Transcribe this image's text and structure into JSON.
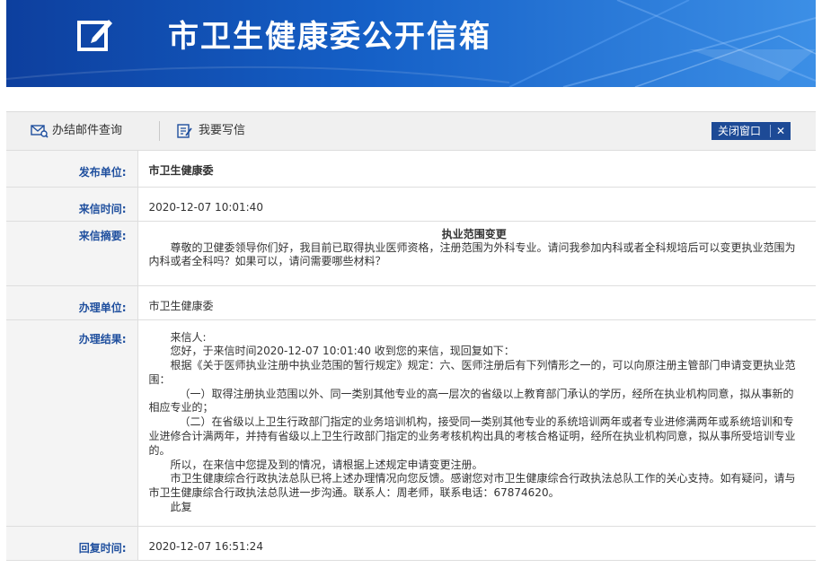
{
  "banner": {
    "title": "市卫生健康委公开信箱",
    "logo_icon": "edit-square-icon"
  },
  "toolbar": {
    "query_label": "办结邮件查询",
    "query_icon": "mail-search-icon",
    "write_label": "我要写信",
    "write_icon": "pen-paper-icon",
    "close_label": "关闭窗口",
    "close_icon": "close-x-icon"
  },
  "fields": {
    "publisher": {
      "label": "发布单位:",
      "value": "市卫生健康委"
    },
    "received_time": {
      "label": "来信时间:",
      "value": "2020-12-07 10:01:40"
    },
    "summary": {
      "label": "来信摘要:",
      "title": "执业范围变更",
      "body": "尊敬的卫健委领导你们好，我目前已取得执业医师资格，注册范围为外科专业。请问我参加内科或者全科规培后可以变更执业范围为内科或者全科吗？如果可以，请问需要哪些材料？"
    },
    "handler": {
      "label": "办理单位:",
      "value": "市卫生健康委"
    },
    "result": {
      "label": "办理结果:",
      "lines": [
        "来信人:",
        "您好，于来信时间2020-12-07 10:01:40 收到您的来信，现回复如下：",
        "根据《关于医师执业注册中执业范围的暂行规定》规定：六、医师注册后有下列情形之一的，可以向原注册主管部门申请变更执业范围：",
        "（一）取得注册执业范围以外、同一类别其他专业的高一层次的省级以上教育部门承认的学历，经所在执业机构同意，拟从事新的相应专业的；",
        "（二）在省级以上卫生行政部门指定的业务培训机构，接受同一类别其他专业的系统培训两年或者专业进修满两年或系统培训和专业进修合计满两年，并持有省级以上卫生行政部门指定的业务考核机构出具的考核合格证明，经所在执业机构同意，拟从事所受培训专业的。",
        "所以，在来信中您提及到的情况，请根据上述规定申请变更注册。",
        "市卫生健康综合行政执法总队已将上述办理情况向您反馈。感谢您对市卫生健康综合行政执法总队工作的关心支持。如有疑问，请与市卫生健康综合行政执法总队进一步沟通。联系人：周老师，联系电话：67874620。",
        "此复"
      ]
    },
    "reply_time": {
      "label": "回复时间:",
      "value": "2020-12-07 16:51:24"
    }
  },
  "colors": {
    "banner_dark": "#0d3f9e",
    "banner_light": "#3c8fe6",
    "label_blue": "#1f4f9e",
    "button_navy": "#1d4a96"
  }
}
